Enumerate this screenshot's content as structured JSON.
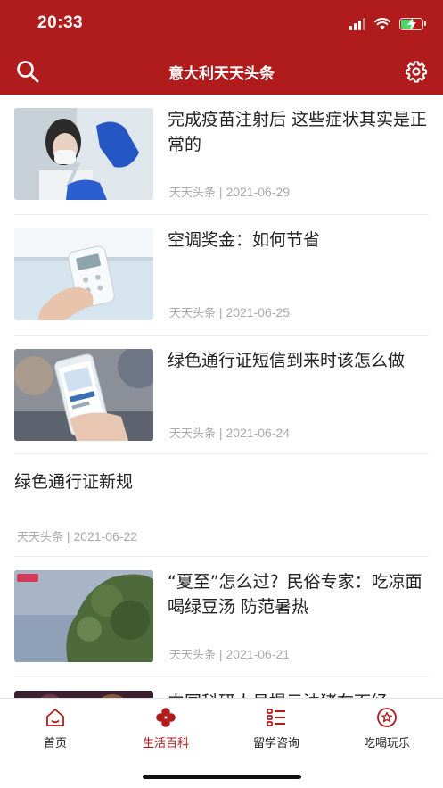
{
  "status": {
    "time": "20:33"
  },
  "nav": {
    "title": "意大利天天头条",
    "search_icon": "search-icon",
    "settings_icon": "gear-icon"
  },
  "colors": {
    "brand": "#b01c1c",
    "meta": "#aaaaaa",
    "battery": "#4cd964"
  },
  "articles": [
    {
      "title": "完成疫苗注射后 这些症状其实是正常的",
      "source": "天天头条",
      "date": "2021-06-29",
      "has_image": true
    },
    {
      "title": "空调奖金：如何节省",
      "source": "天天头条",
      "date": "2021-06-25",
      "has_image": true
    },
    {
      "title": "绿色通行证短信到来时该怎么做",
      "source": "天天头条",
      "date": "2021-06-24",
      "has_image": true
    },
    {
      "title": "绿色通行证新规",
      "source": "天天头条",
      "date": "2021-06-22",
      "has_image": false
    },
    {
      "title": "“夏至”怎么过？民俗专家：吃凉面 喝绿豆汤 防范暑热",
      "source": "天天头条",
      "date": "2021-06-21",
      "has_image": true
    },
    {
      "title": "中国科研人员提示油猪在面经",
      "has_image": true
    }
  ],
  "tabs": [
    {
      "label": "首页",
      "icon": "home-icon",
      "active": false
    },
    {
      "label": "生活百科",
      "icon": "clover-icon",
      "active": true
    },
    {
      "label": "留学咨询",
      "icon": "list-icon",
      "active": false
    },
    {
      "label": "吃喝玩乐",
      "icon": "star-badge-icon",
      "active": false
    }
  ]
}
